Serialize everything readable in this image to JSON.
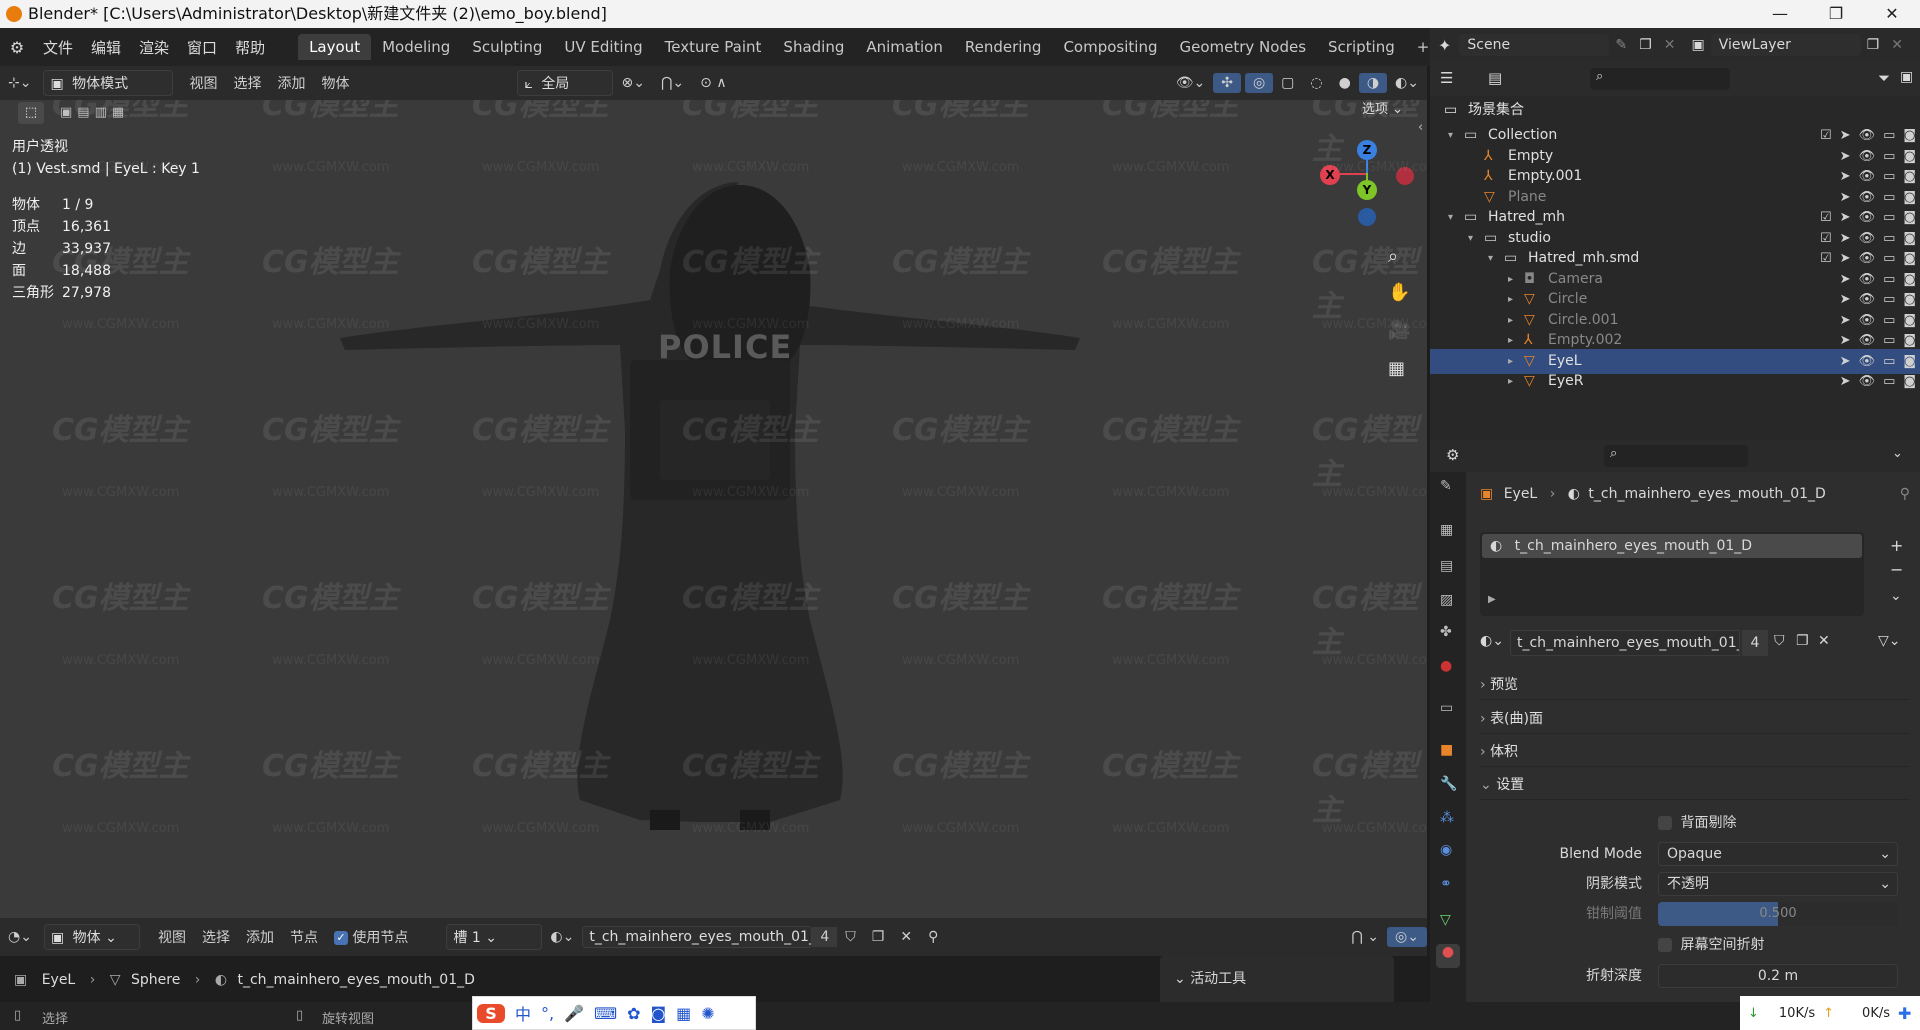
{
  "window": {
    "title": "Blender* [C:\\Users\\Administrator\\Desktop\\新建文件夹 (2)\\emo_boy.blend]",
    "minimize": "—",
    "maximize": "❐",
    "close": "✕"
  },
  "menu": [
    "文件",
    "编辑",
    "渲染",
    "窗口",
    "帮助"
  ],
  "workspaces": [
    "Layout",
    "Modeling",
    "Sculpting",
    "UV Editing",
    "Texture Paint",
    "Shading",
    "Animation",
    "Rendering",
    "Compositing",
    "Geometry Nodes",
    "Scripting"
  ],
  "workspace_add": "+",
  "active_workspace": "Layout",
  "scene": {
    "label": "Scene",
    "viewlayer": "ViewLayer"
  },
  "viewport_header": {
    "mode": "物体模式",
    "menus": [
      "视图",
      "选择",
      "添加",
      "物体"
    ],
    "transform": "全局",
    "options": "选项"
  },
  "viewport": {
    "view_name": "用户透视",
    "context": "(1) Vest.smd | EyeL : Key 1",
    "stats": [
      {
        "label": "物体",
        "value": "1 / 9"
      },
      {
        "label": "顶点",
        "value": "16,361"
      },
      {
        "label": "边",
        "value": "33,937"
      },
      {
        "label": "面",
        "value": "18,488"
      },
      {
        "label": "三角形",
        "value": "27,978"
      }
    ],
    "gizmo": {
      "x": "X",
      "y": "Y",
      "z": "Z"
    },
    "vest_text": "POLICE",
    "watermark": "CG模型主",
    "watermark_url": "www.CGMXW.com"
  },
  "outliner": {
    "root": "场景集合",
    "rows": [
      {
        "label": "Collection",
        "indent": 1,
        "icon": "collection"
      },
      {
        "label": "Empty",
        "indent": 2,
        "icon": "empty"
      },
      {
        "label": "Empty.001",
        "indent": 2,
        "icon": "empty"
      },
      {
        "label": "Plane",
        "indent": 2,
        "icon": "mesh",
        "dim": true
      },
      {
        "label": "Hatred_mh",
        "indent": 1,
        "icon": "collection"
      },
      {
        "label": "studio",
        "indent": 2,
        "icon": "collection"
      },
      {
        "label": "Hatred_mh.smd",
        "indent": 3,
        "icon": "collection"
      },
      {
        "label": "Camera",
        "indent": 4,
        "icon": "camera",
        "dim": true
      },
      {
        "label": "Circle",
        "indent": 4,
        "icon": "mesh",
        "dim": true
      },
      {
        "label": "Circle.001",
        "indent": 4,
        "icon": "mesh",
        "dim": true
      },
      {
        "label": "Empty.002",
        "indent": 4,
        "icon": "empty",
        "dim": true
      },
      {
        "label": "EyeL",
        "indent": 4,
        "icon": "mesh",
        "selected": true
      },
      {
        "label": "EyeR",
        "indent": 4,
        "icon": "mesh"
      }
    ]
  },
  "properties": {
    "breadcrumb_object": "EyeL",
    "breadcrumb_material": "t_ch_mainhero_eyes_mouth_01_D",
    "slot": "t_ch_mainhero_eyes_mouth_01_D",
    "material_name": "t_ch_mainhero_eyes_mouth_01_D",
    "users": "4",
    "panels": [
      "预览",
      "表(曲)面",
      "体积",
      "设置"
    ],
    "backface_culling": "背面剔除",
    "blend_mode_label": "Blend Mode",
    "blend_mode": "Opaque",
    "shadow_mode_label": "阴影模式",
    "shadow_mode": "不透明",
    "clip_threshold_label": "钳制阈值",
    "clip_threshold": "0.500",
    "clip_threshold_fraction": 0.5,
    "screen_refraction": "屏幕空间折射",
    "refraction_depth_label": "折射深度",
    "refraction_depth": "0.2 m"
  },
  "node_header": {
    "mode": "物体",
    "menus": [
      "视图",
      "选择",
      "添加",
      "节点"
    ],
    "use_nodes": "使用节点",
    "slot": "槽 1",
    "material": "t_ch_mainhero_eyes_mouth_01_D",
    "users": "4",
    "breadcrumb": [
      "EyeL",
      "Sphere",
      "t_ch_mainhero_eyes_mouth_01_D"
    ],
    "active_tool": "活动工具"
  },
  "statusbar": {
    "select": "选择",
    "rotate": "旋转视图",
    "download": "10K/s",
    "upload": "0K/s"
  },
  "colors": {
    "selection": "#334d80",
    "accent_orange": "#e87d0d",
    "axis_x": "#e0404f",
    "axis_y": "#7ec528",
    "axis_z": "#3a80e0"
  }
}
